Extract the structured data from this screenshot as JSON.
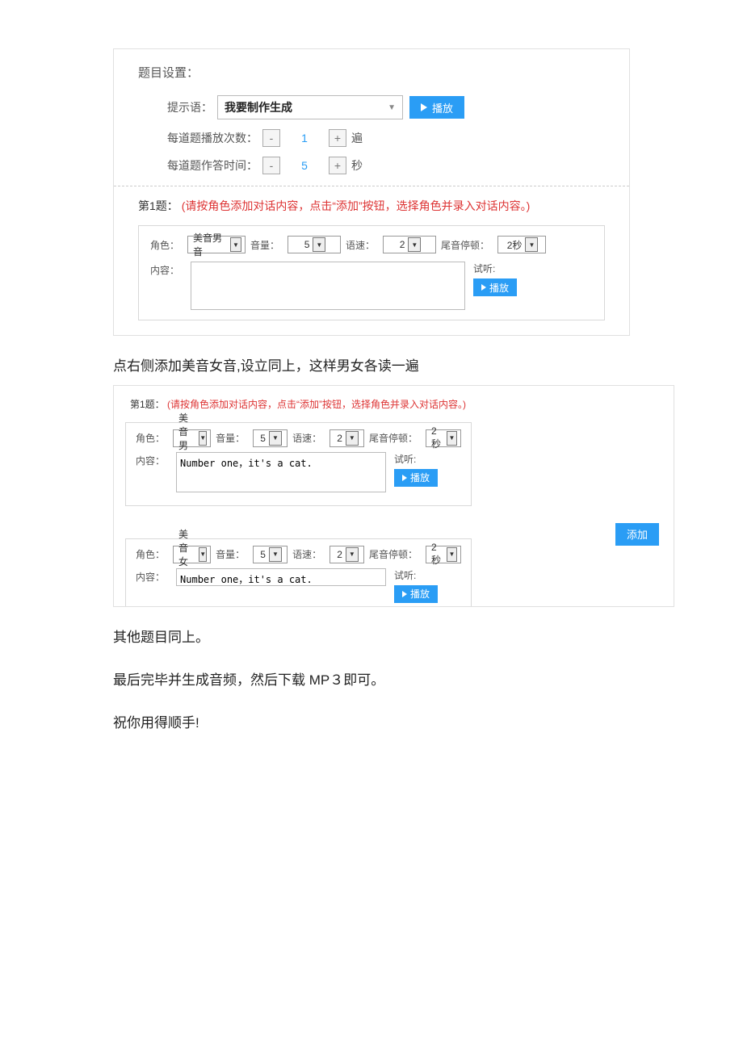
{
  "settings": {
    "title": "题目设置：",
    "prompt_label": "提示语：",
    "prompt_value": "我要制作生成",
    "play_label": "播放",
    "play_count_label": "每道题播放次数：",
    "play_count_value": "1",
    "play_count_unit": "遍",
    "answer_time_label": "每道题作答时间：",
    "answer_time_value": "5",
    "answer_time_unit": "秒"
  },
  "q1a": {
    "header_prefix": "第1题：",
    "header_red": "(请按角色添加对话内容，点击“添加”按钮，选择角色并录入对话内容。)",
    "role_label": "角色：",
    "role_value": "美音男音",
    "volume_label": "音量：",
    "volume_value": "5",
    "speed_label": "语速：",
    "speed_value": "2",
    "tail_label": "尾音停顿：",
    "tail_value": "2秒",
    "content_label": "内容：",
    "content_value": "",
    "test_label": "试听:",
    "play_label": "播放"
  },
  "body1": "点右侧添加美音女音,设立同上，这样男女各读一遍",
  "q1b": {
    "header_prefix": "第1题：",
    "header_red": "(请按角色添加对话内容，点击“添加”按钮，选择角色并录入对话内容。)",
    "add_label": "添加",
    "row1": {
      "role_label": "角色：",
      "role_value": "美音男音",
      "volume_label": "音量：",
      "volume_value": "5",
      "speed_label": "语速：",
      "speed_value": "2",
      "tail_label": "尾音停顿：",
      "tail_value": "2秒",
      "content_label": "内容：",
      "content_value": "Number one，it's a cat.",
      "test_label": "试听:",
      "play_label": "播放"
    },
    "row2": {
      "role_label": "角色：",
      "role_value": "美音女音",
      "volume_label": "音量：",
      "volume_value": "5",
      "speed_label": "语速：",
      "speed_value": "2",
      "tail_label": "尾音停顿：",
      "tail_value": "2秒",
      "content_label": "内容：",
      "content_value": "Number one，it's a cat.",
      "test_label": "试听:",
      "play_label": "播放"
    }
  },
  "body2": "其他题目同上。",
  "body3": "最后完毕并生成音频，然后下载 MP３即可。",
  "body4": "祝你用得顺手!"
}
